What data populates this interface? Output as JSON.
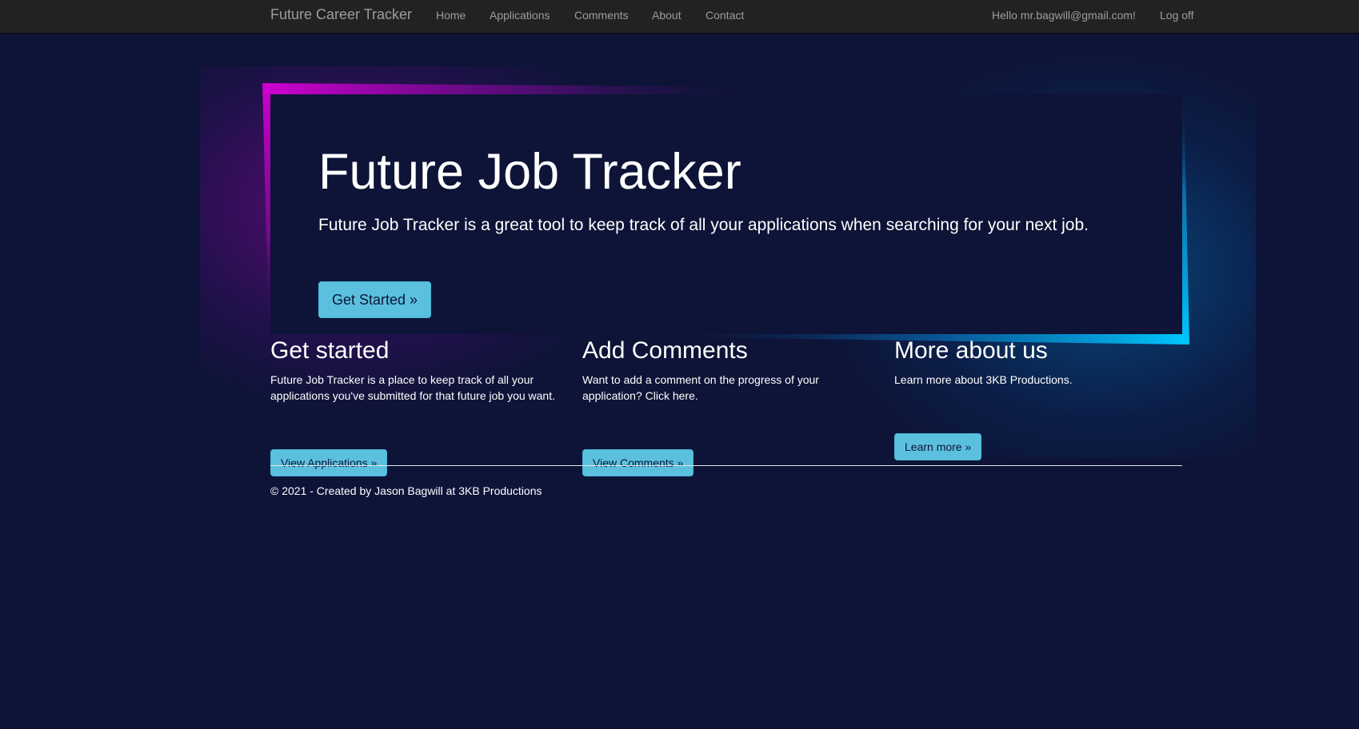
{
  "navbar": {
    "brand": "Future Career Tracker",
    "links": [
      "Home",
      "Applications",
      "Comments",
      "About",
      "Contact"
    ],
    "greeting": "Hello mr.bagwill@gmail.com!",
    "logoff": "Log off"
  },
  "hero": {
    "title": "Future Job Tracker",
    "lead": "Future Job Tracker is a great tool to keep track of all your applications when searching for your next job.",
    "button": "Get Started »"
  },
  "columns": [
    {
      "heading": "Get started",
      "text": "Future Job Tracker is a place to keep track of all your applications you've submitted for that future job you want.",
      "button": "View Applications »"
    },
    {
      "heading": "Add Comments",
      "text": "Want to add a comment on the progress of your application? Click here.",
      "button": "View Comments »"
    },
    {
      "heading": "More about us",
      "text": "Learn more about 3KB Productions.",
      "button": "Learn more »"
    }
  ],
  "footer": {
    "text": "© 2021 - Created by Jason Bagwill at 3KB Productions"
  },
  "colors": {
    "background": "#0d1437",
    "navbar": "#222222",
    "accent_button": "#5bc0de",
    "frame_magenta": "#cc00cc",
    "frame_cyan": "#00c8ff"
  }
}
